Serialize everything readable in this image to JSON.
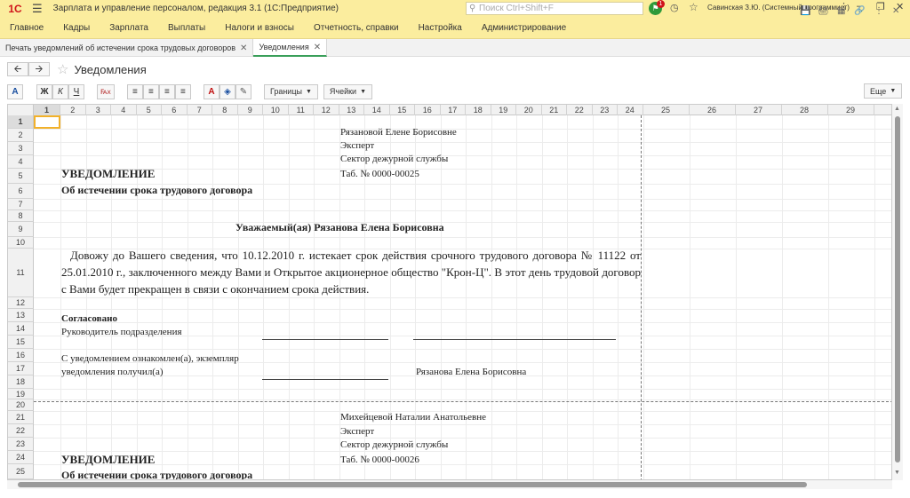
{
  "titlebar": {
    "logo": "1С",
    "title": "Зарплата и управление персоналом, редакция 3.1  (1С:Предприятие)",
    "search_placeholder": "Поиск Ctrl+Shift+F",
    "notif_count": "1",
    "user": "Савинская З.Ю. (Системный программист)"
  },
  "menu": [
    "Главное",
    "Кадры",
    "Зарплата",
    "Выплаты",
    "Налоги и взносы",
    "Отчетность, справки",
    "Настройка",
    "Администрирование"
  ],
  "tabs": [
    {
      "label": "Печать уведомлений об истечении срока трудовых договоров"
    },
    {
      "label": "Уведомления"
    }
  ],
  "form": {
    "title": "Уведомления"
  },
  "toolbar": {
    "a_label": "A",
    "bold": "Ж",
    "italic": "К",
    "underline": "Ч",
    "borders": "Границы",
    "cells": "Ячейки",
    "more": "Еще"
  },
  "columns": [
    "1",
    "2",
    "3",
    "4",
    "5",
    "6",
    "7",
    "8",
    "9",
    "10",
    "11",
    "12",
    "13",
    "14",
    "15",
    "16",
    "17",
    "18",
    "19",
    "20",
    "21",
    "22",
    "23",
    "24",
    "25",
    "26",
    "27",
    "28",
    "29"
  ],
  "rows": [
    "1",
    "2",
    "3",
    "4",
    "5",
    "6",
    "7",
    "8",
    "9",
    "10",
    "11",
    "12",
    "13",
    "14",
    "15",
    "16",
    "17",
    "18",
    "19",
    "20",
    "21",
    "22",
    "23",
    "24",
    "25",
    "26"
  ],
  "doc1": {
    "recipient": "Рязановой Елене Борисовне",
    "position": "Эксперт",
    "department": "Сектор дежурной службы",
    "tab_no": "Таб. № 0000-00025",
    "heading": "УВЕДОМЛЕНИЕ",
    "subheading": "Об истечении срока трудового договора",
    "salutation": "Уважаемый(ая) Рязанова Елена Борисовна",
    "body": "Довожу до Вашего сведения, что 10.12.2010 г. истекает срок действия срочного трудового договора № 11122 от 25.01.2010 г., заключенного между Вами и Открытое акционерное общество \"Крон-Ц\". В этот день трудовой договор с Вами будет прекращен в связи с окончанием срока действия.",
    "agreed": "Согласовано",
    "head_of_dept": "Руководитель подразделения",
    "ack1": "С уведомлением ознакомлен(а), экземпляр",
    "ack2": "уведомления получил(а)",
    "signer": "Рязанова Елена Борисовна"
  },
  "doc2": {
    "recipient": "Михейцевой Наталии Анатольевне",
    "position": "Эксперт",
    "department": "Сектор дежурной службы",
    "tab_no": "Таб. № 0000-00026",
    "heading": "УВЕДОМЛЕНИЕ",
    "subheading": "Об истечении срока трудового договора"
  }
}
